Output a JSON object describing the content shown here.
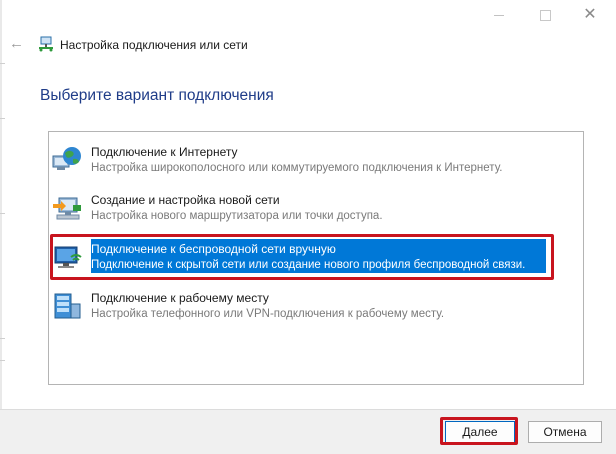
{
  "window": {
    "controls": {
      "minimize_icon": "minimize-icon",
      "maximize_icon": "maximize-icon",
      "close_icon": "close-icon",
      "close_glyph": "✕"
    }
  },
  "header": {
    "back_glyph": "←",
    "title": "Настройка подключения или сети"
  },
  "main": {
    "heading": "Выберите вариант подключения",
    "options": [
      {
        "icon": "globe-network-icon",
        "title": "Подключение к Интернету",
        "description": "Настройка широкополосного или коммутируемого подключения к Интернету.",
        "selected": false
      },
      {
        "icon": "new-network-icon",
        "title": "Создание и настройка новой сети",
        "description": "Настройка нового маршрутизатора или точки доступа.",
        "selected": false
      },
      {
        "icon": "wireless-monitor-icon",
        "title": "Подключение к беспроводной сети вручную",
        "description": "Подключение к скрытой сети или создание нового профиля беспроводной связи.",
        "selected": true
      },
      {
        "icon": "workplace-icon",
        "title": "Подключение к рабочему месту",
        "description": "Настройка телефонного или VPN-подключения к рабочему месту.",
        "selected": false
      }
    ]
  },
  "footer": {
    "next_label": "Далее",
    "cancel_label": "Отмена"
  },
  "colors": {
    "heading": "#1f3c88",
    "selection": "#0078d7",
    "highlight_frame": "#c8141e"
  }
}
